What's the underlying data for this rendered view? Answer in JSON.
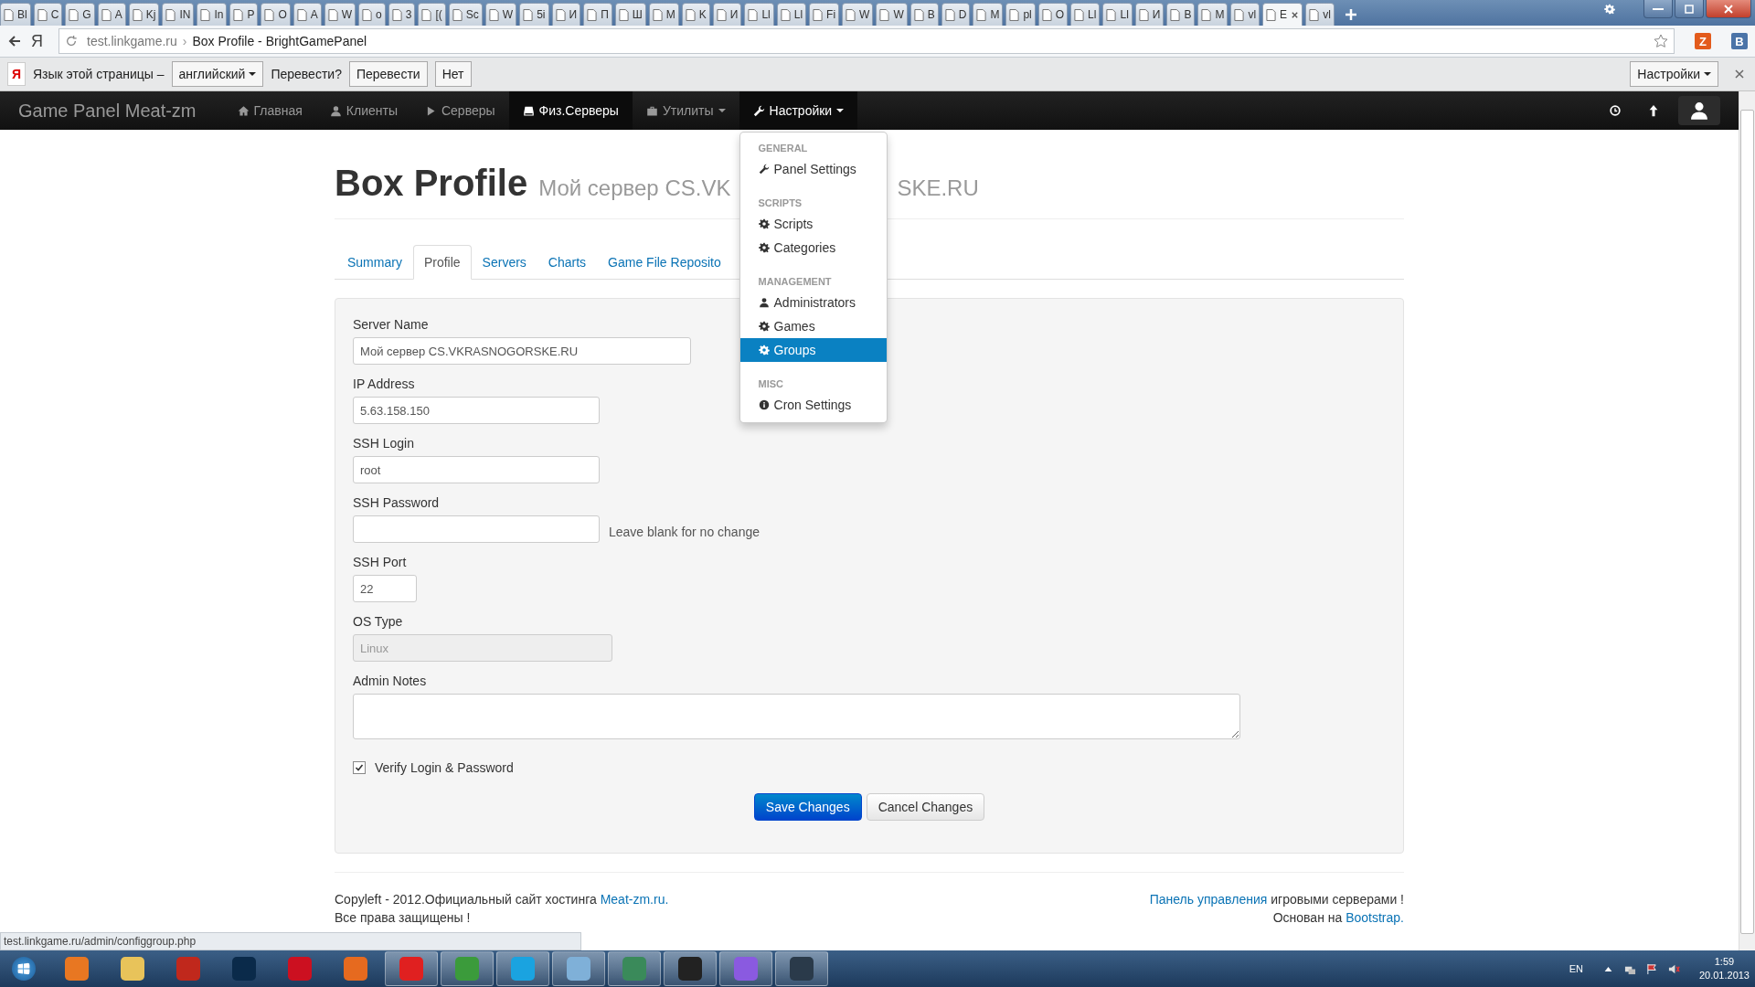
{
  "browser": {
    "tabs": [
      {
        "label": "Bl",
        "selected": false
      },
      {
        "label": "C",
        "selected": false
      },
      {
        "label": "G",
        "selected": false
      },
      {
        "label": "A",
        "selected": false
      },
      {
        "label": "Kj",
        "selected": false
      },
      {
        "label": "IN",
        "selected": false
      },
      {
        "label": "In",
        "selected": false
      },
      {
        "label": "P",
        "selected": false
      },
      {
        "label": "O",
        "selected": false
      },
      {
        "label": "A",
        "selected": false
      },
      {
        "label": "W",
        "selected": false
      },
      {
        "label": "o",
        "selected": false
      },
      {
        "label": "3",
        "selected": false
      },
      {
        "label": "[(",
        "selected": false
      },
      {
        "label": "Sc",
        "selected": false
      },
      {
        "label": "W",
        "selected": false
      },
      {
        "label": "5i",
        "selected": false
      },
      {
        "label": "И",
        "selected": false
      },
      {
        "label": "П",
        "selected": false
      },
      {
        "label": "Ш",
        "selected": false
      },
      {
        "label": "M",
        "selected": false
      },
      {
        "label": "K",
        "selected": false
      },
      {
        "label": "И",
        "selected": false
      },
      {
        "label": "Ll",
        "selected": false
      },
      {
        "label": "Ll",
        "selected": false
      },
      {
        "label": "Fi",
        "selected": false
      },
      {
        "label": "W",
        "selected": false
      },
      {
        "label": "W",
        "selected": false
      },
      {
        "label": "B",
        "selected": false
      },
      {
        "label": "D",
        "selected": false
      },
      {
        "label": "M",
        "selected": false
      },
      {
        "label": "pl",
        "selected": false
      },
      {
        "label": "O",
        "selected": false
      },
      {
        "label": "Ll",
        "selected": false
      },
      {
        "label": "Ll",
        "selected": false
      },
      {
        "label": "И",
        "selected": false
      },
      {
        "label": "B",
        "selected": false
      },
      {
        "label": "M",
        "selected": false
      },
      {
        "label": "vl",
        "selected": false
      },
      {
        "label": "E",
        "selected": true
      },
      {
        "label": "vl",
        "selected": false
      }
    ],
    "logo": "Я",
    "address": {
      "domain": "test.linkgame.ru",
      "separator": "›",
      "title": "Box Profile - BrightGamePanel"
    },
    "extensions": [
      "Z",
      "B"
    ]
  },
  "translate_bar": {
    "logo": "Я",
    "label": "Язык этой страницы –",
    "language": "английский",
    "question": "Перевести?",
    "buttons": [
      "Перевести",
      "Нет"
    ],
    "settings": "Настройки"
  },
  "navbar": {
    "brand": "Game Panel Meat-zm",
    "items": [
      {
        "kind": "home",
        "label": "Главная",
        "selected": false,
        "dropdown": false
      },
      {
        "kind": "user",
        "label": "Клиенты",
        "selected": false,
        "dropdown": false
      },
      {
        "kind": "play",
        "label": "Серверы",
        "selected": false,
        "dropdown": false
      },
      {
        "kind": "hdd",
        "label": "Физ.Серверы",
        "selected": true,
        "dropdown": false
      },
      {
        "kind": "briefcase",
        "label": "Утилиты",
        "selected": false,
        "dropdown": true
      },
      {
        "kind": "wrench",
        "label": "Настройки",
        "selected": true,
        "dropdown": true,
        "expanded": true
      }
    ],
    "menu": [
      {
        "header": "GENERAL",
        "items": [
          {
            "kind": "wrench",
            "label": "Panel Settings",
            "selected": false
          }
        ]
      },
      {
        "header": "SCRIPTS",
        "items": [
          {
            "kind": "cog",
            "label": "Scripts",
            "selected": false
          },
          {
            "kind": "cog",
            "label": "Categories",
            "selected": false
          }
        ]
      },
      {
        "header": "MANAGEMENT",
        "items": [
          {
            "kind": "user",
            "label": "Administrators",
            "selected": false
          },
          {
            "kind": "cog",
            "label": "Games",
            "selected": false
          },
          {
            "kind": "cog",
            "label": "Groups",
            "selected": true
          }
        ]
      },
      {
        "header": "MISC",
        "items": [
          {
            "kind": "info",
            "label": "Cron Settings",
            "selected": false
          }
        ]
      }
    ]
  },
  "page": {
    "title": "Box Profile",
    "subtitle_parts": [
      "Мой сервер CS.VK",
      "SKE.RU"
    ],
    "tabs": [
      {
        "label": "Summary",
        "selected": false
      },
      {
        "label": "Profile",
        "selected": true
      },
      {
        "label": "Servers",
        "selected": false
      },
      {
        "label": "Charts",
        "selected": false
      },
      {
        "label": "Game File Reposito",
        "selected": false
      }
    ],
    "form": {
      "fields": [
        {
          "label": "Server Name",
          "value": "Мой сервер CS.VKRASNOGORSKE.RU",
          "kind": "input",
          "disabled": false
        },
        {
          "label": "IP Address",
          "value": "5.63.158.150",
          "kind": "input",
          "disabled": false
        },
        {
          "label": "SSH Login",
          "value": "root",
          "kind": "input",
          "disabled": false
        },
        {
          "label": "SSH Password",
          "kind": "input",
          "disabled": false,
          "help": "Leave blank for no change"
        },
        {
          "label": "SSH Port",
          "value": "22",
          "kind": "input",
          "disabled": false
        },
        {
          "label": "OS Type",
          "value": "Linux",
          "kind": "select",
          "disabled": true
        },
        {
          "label": "Admin Notes",
          "kind": "textarea",
          "disabled": false
        }
      ],
      "checkbox": {
        "label": "Verify Login & Password",
        "checked": true
      },
      "buttons": [
        {
          "label": "Save Changes",
          "kind": "primary"
        },
        {
          "label": "Cancel Changes",
          "kind": "default"
        }
      ]
    },
    "footer": {
      "left": [
        {
          "text": "Copyleft - 2012.Официальный сайт хостинга ",
          "link": "Meat-zm.ru."
        },
        {
          "text": "Все права защищены !"
        }
      ],
      "right": [
        {
          "link": "Панель управления",
          "text": " игровыми серверами !"
        },
        {
          "text": "Основан на ",
          "link": "Bootstrap."
        }
      ]
    }
  },
  "status_url": "test.linkgame.ru/admin/configgroup.php",
  "taskbar": {
    "apps": [
      {
        "kind": "media",
        "running": false
      },
      {
        "kind": "folder",
        "running": false
      },
      {
        "kind": "ftp",
        "running": false
      },
      {
        "kind": "ps",
        "running": false
      },
      {
        "kind": "opera",
        "running": false
      },
      {
        "kind": "firefox",
        "running": false
      },
      {
        "kind": "yandex",
        "running": true
      },
      {
        "kind": "chrome",
        "running": true
      },
      {
        "kind": "skype",
        "running": true
      },
      {
        "kind": "notes",
        "running": true
      },
      {
        "kind": "network",
        "running": true
      },
      {
        "kind": "terminal",
        "running": true
      },
      {
        "kind": "chat",
        "running": true
      },
      {
        "kind": "steam",
        "running": true
      }
    ],
    "language": "EN",
    "time": "1:59",
    "date": "20.01.2013"
  }
}
